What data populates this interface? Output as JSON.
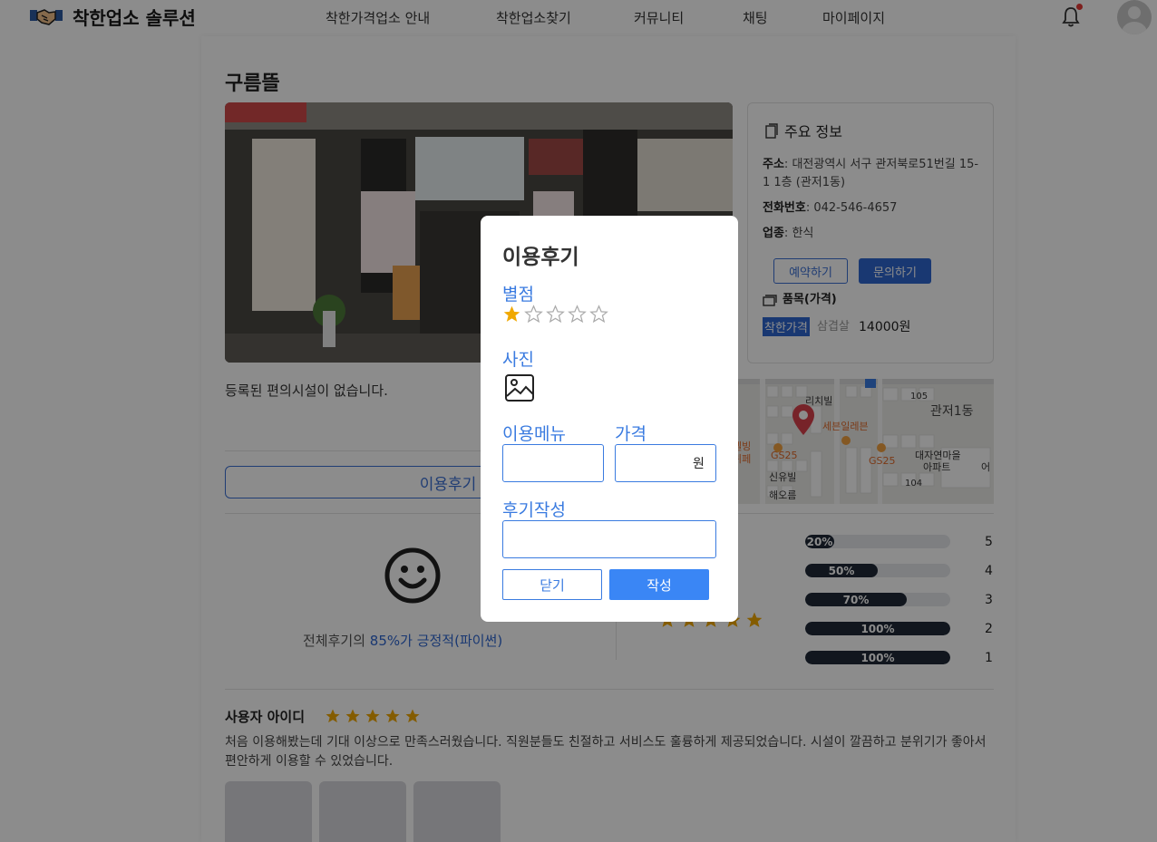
{
  "header": {
    "logo_text": "착한업소 솔루션",
    "nav": [
      "착한가격업소 안내",
      "착한업소찾기",
      "커뮤니티",
      "채팅",
      "마이페이지"
    ]
  },
  "store": {
    "name": "구름뜰",
    "info_title": "주요 정보",
    "address_label": "주소",
    "address": "대전광역시 서구 관저북로51번길 15-1 1층 (관저1동)",
    "phone_label": "전화번호",
    "phone": "042-546-4657",
    "category_label": "업종",
    "category": "한식",
    "reserve_label": "예약하기",
    "inquiry_label": "문의하기",
    "items_title": "품목(가격)",
    "price_badge": "착한가격",
    "item_name": "삼겹살",
    "item_price": "14000원",
    "facility_text": "등록된 편의시설이 없습니다.",
    "write_review_label": "이용후기 작성하기"
  },
  "map": {
    "labels": [
      "리치빌",
      "105",
      "관저1동",
      "세븐일레븐",
      "GS25",
      "GS25",
      "대자연마을",
      "아파트",
      "신유빌",
      "해오름",
      "104",
      "어",
      "렐빙",
      "뷔페"
    ]
  },
  "ratings": {
    "summary_prefix": "전체후기의 ",
    "summary_highlight": "85%가 긍정적(파이썬)",
    "average_stars": 5,
    "bars": [
      {
        "label": "20%",
        "value": 20,
        "score": "5"
      },
      {
        "label": "50%",
        "value": 50,
        "score": "4"
      },
      {
        "label": "70%",
        "value": 70,
        "score": "3"
      },
      {
        "label": "100%",
        "value": 100,
        "score": "2"
      },
      {
        "label": "100%",
        "value": 100,
        "score": "1"
      }
    ]
  },
  "review": {
    "user": "사용자 아이디",
    "stars": 5,
    "text": "처음 이용해봤는데 기대 이상으로 만족스러웠습니다. 직원분들도 친절하고 서비스도 훌륭하게 제공되었습니다. 시설이 깔끔하고 분위기가 좋아서 편안하게 이용할 수 있었습니다."
  },
  "modal": {
    "title": "이용후기",
    "rating_label": "별점",
    "rating_value": 1,
    "rating_max": 5,
    "photo_label": "사진",
    "menu_label": "이용메뉴",
    "menu_value": "",
    "price_label": "가격",
    "price_value": "",
    "price_unit": "원",
    "review_label": "후기작성",
    "review_value": "",
    "close_label": "닫기",
    "submit_label": "작성"
  },
  "colors": {
    "accent": "#3a7be0",
    "primary_button": "#2f66d0",
    "star": "#f0a800",
    "bar_fill": "#1f2937"
  }
}
